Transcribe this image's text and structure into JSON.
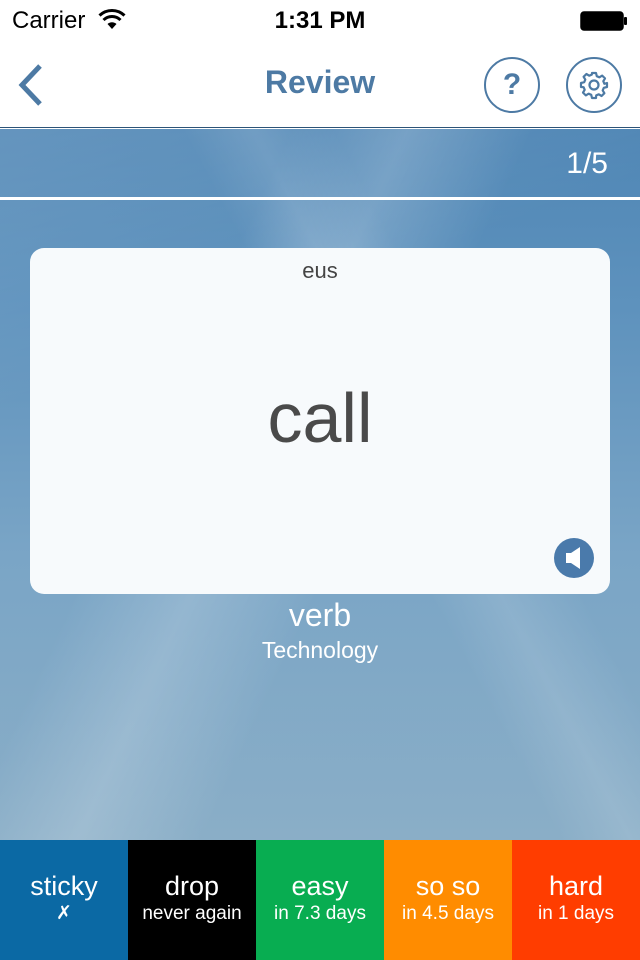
{
  "status_bar": {
    "carrier": "Carrier",
    "time": "1:31 PM",
    "wifi_icon": "wifi-icon",
    "battery_icon": "battery-full-icon"
  },
  "nav": {
    "back_icon": "chevron-left-icon",
    "title": "Review",
    "help_label": "?",
    "settings_icon": "gear-icon"
  },
  "review": {
    "progress": "1/5",
    "card": {
      "language": "eus",
      "word": "call",
      "speaker_icon": "speaker-icon"
    },
    "part_of_speech": "verb",
    "category": "Technology"
  },
  "answers": [
    {
      "id": "sticky",
      "label": "sticky",
      "sub": "✗",
      "color": "#0b69a4"
    },
    {
      "id": "drop",
      "label": "drop",
      "sub": "never again",
      "color": "#000000"
    },
    {
      "id": "easy",
      "label": "easy",
      "sub": "in 7.3 days",
      "color": "#08ad51"
    },
    {
      "id": "so-so",
      "label": "so so",
      "sub": "in 4.5 days",
      "color": "#ff8c00"
    },
    {
      "id": "hard",
      "label": "hard",
      "sub": "in 1 days",
      "color": "#ff3d00"
    }
  ],
  "colors": {
    "accent": "#4d7aa4",
    "card_text": "#4a4a4a",
    "speaker_bg": "#4a7aab"
  }
}
